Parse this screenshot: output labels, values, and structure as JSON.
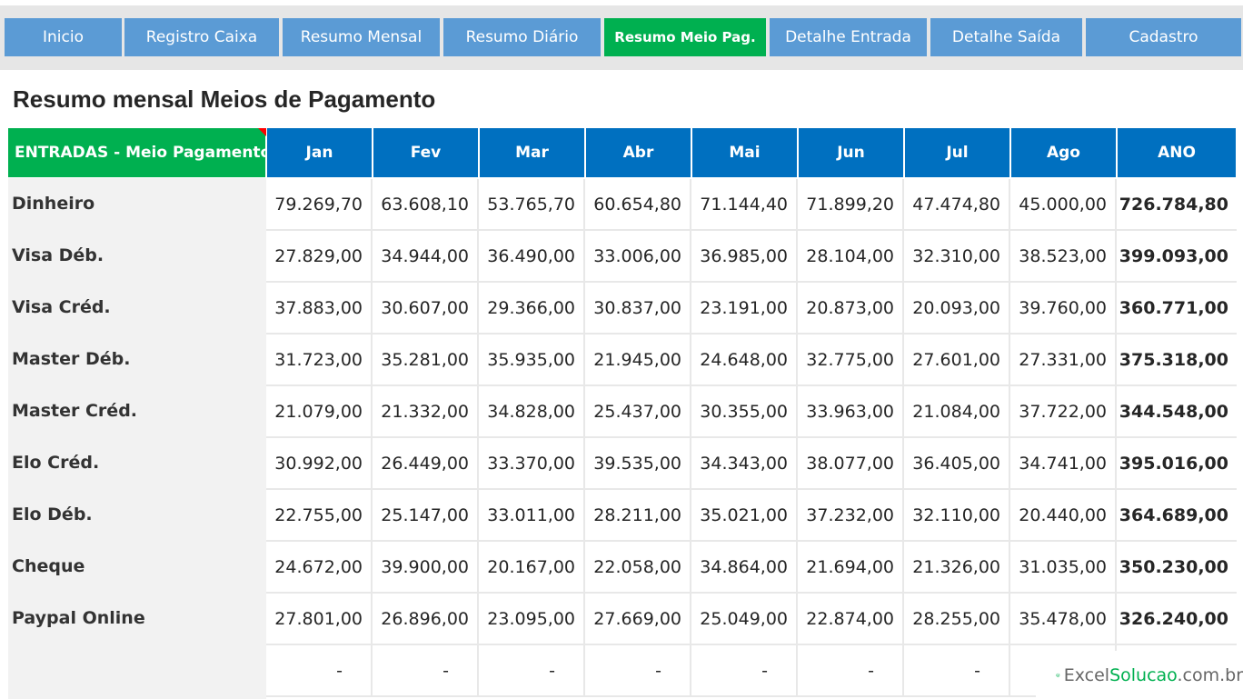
{
  "nav": {
    "items": [
      {
        "label": "Inicio",
        "active": false
      },
      {
        "label": "Registro Caixa",
        "active": false
      },
      {
        "label": "Resumo Mensal",
        "active": false
      },
      {
        "label": "Resumo Diário",
        "active": false
      },
      {
        "label": "Resumo Meio Pag.",
        "active": true
      },
      {
        "label": "Detalhe Entrada",
        "active": false
      },
      {
        "label": "Detalhe Saída",
        "active": false
      },
      {
        "label": "Cadastro",
        "active": false
      }
    ]
  },
  "page": {
    "title": "Resumo mensal Meios de Pagamento"
  },
  "table": {
    "corner_header": "ENTRADAS - Meio Pagamento",
    "columns": [
      "Jan",
      "Fev",
      "Mar",
      "Abr",
      "Mai",
      "Jun",
      "Jul",
      "Ago",
      "ANO"
    ],
    "rows": [
      {
        "label": "Dinheiro",
        "values": [
          "79.269,70",
          "63.608,10",
          "53.765,70",
          "60.654,80",
          "71.144,40",
          "71.899,20",
          "47.474,80",
          "45.000,00"
        ],
        "total": "726.784,80"
      },
      {
        "label": "Visa Déb.",
        "values": [
          "27.829,00",
          "34.944,00",
          "36.490,00",
          "33.006,00",
          "36.985,00",
          "28.104,00",
          "32.310,00",
          "38.523,00"
        ],
        "total": "399.093,00"
      },
      {
        "label": "Visa Créd.",
        "values": [
          "37.883,00",
          "30.607,00",
          "29.366,00",
          "30.837,00",
          "23.191,00",
          "20.873,00",
          "20.093,00",
          "39.760,00"
        ],
        "total": "360.771,00"
      },
      {
        "label": "Master Déb.",
        "values": [
          "31.723,00",
          "35.281,00",
          "35.935,00",
          "21.945,00",
          "24.648,00",
          "32.775,00",
          "27.601,00",
          "27.331,00"
        ],
        "total": "375.318,00"
      },
      {
        "label": "Master Créd.",
        "values": [
          "21.079,00",
          "21.332,00",
          "34.828,00",
          "25.437,00",
          "30.355,00",
          "33.963,00",
          "21.084,00",
          "37.722,00"
        ],
        "total": "344.548,00"
      },
      {
        "label": "Elo Créd.",
        "values": [
          "30.992,00",
          "26.449,00",
          "33.370,00",
          "39.535,00",
          "34.343,00",
          "38.077,00",
          "36.405,00",
          "34.741,00"
        ],
        "total": "395.016,00"
      },
      {
        "label": "Elo Déb.",
        "values": [
          "22.755,00",
          "25.147,00",
          "33.011,00",
          "28.211,00",
          "35.021,00",
          "37.232,00",
          "32.110,00",
          "20.440,00"
        ],
        "total": "364.689,00"
      },
      {
        "label": "Cheque",
        "values": [
          "24.672,00",
          "39.900,00",
          "20.167,00",
          "22.058,00",
          "34.864,00",
          "21.694,00",
          "21.326,00",
          "31.035,00"
        ],
        "total": "350.230,00"
      },
      {
        "label": "Paypal Online",
        "values": [
          "27.801,00",
          "26.896,00",
          "23.095,00",
          "27.669,00",
          "25.049,00",
          "22.874,00",
          "28.255,00",
          "35.478,00"
        ],
        "total": "326.240,00"
      },
      {
        "label": "",
        "values": [
          "-",
          "-",
          "-",
          "-",
          "-",
          "-",
          "-",
          ""
        ],
        "total": ""
      }
    ]
  },
  "logo": {
    "prefix": "Excel",
    "highlight": "Solucao",
    "suffix": ".com.br"
  },
  "colors": {
    "nav_button": "#5b9bd5",
    "nav_active": "#00b050",
    "header_blue": "#0070c0",
    "header_green": "#00b050"
  }
}
